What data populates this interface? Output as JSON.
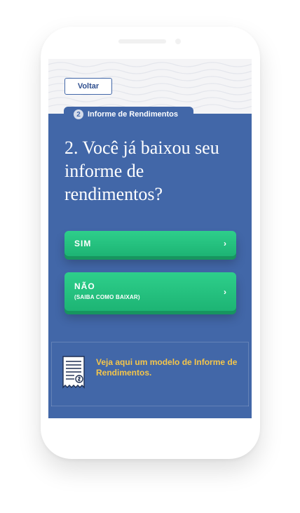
{
  "header": {
    "back_label": "Voltar"
  },
  "step": {
    "number": "2",
    "label": "Informe de Rendimentos"
  },
  "question": "2. Você já baixou seu informe de rendimentos?",
  "options": [
    {
      "label": "SIM",
      "sublabel": ""
    },
    {
      "label": "NÃO",
      "sublabel": "(SAIBA COMO BAIXAR)"
    }
  ],
  "chevron": "›",
  "model_link": "Veja aqui um modelo de Informe de Rendimentos.",
  "icons": [
    "chevron-right-icon",
    "document-icon"
  ],
  "colors": {
    "screen_bg": "#4267a8",
    "button_green": "#22c07e",
    "link_yellow": "#f5c64a"
  }
}
